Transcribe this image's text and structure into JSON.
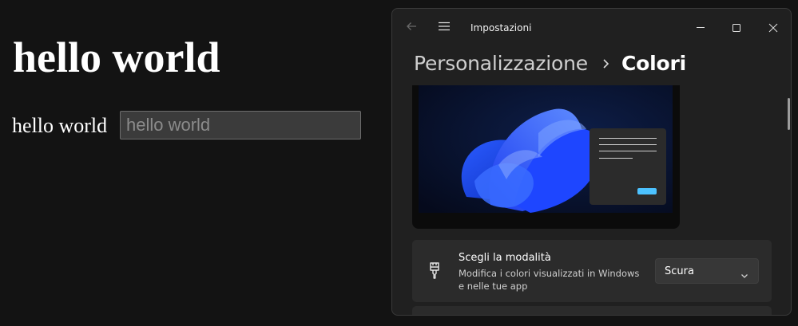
{
  "page": {
    "heading": "hello world",
    "label": "hello world",
    "input_placeholder": "hello world"
  },
  "window": {
    "title": "Impostazioni",
    "icons": {
      "back": "back-arrow-icon",
      "menu": "hamburger-menu-icon",
      "minimize": "minimize-icon",
      "maximize": "maximize-icon",
      "close": "close-icon"
    },
    "breadcrumb": {
      "parent": "Personalizzazione",
      "current": "Colori"
    },
    "mode_setting": {
      "icon": "paintbrush-icon",
      "title": "Scegli la modalità",
      "description": "Modifica i colori visualizzati in Windows e nelle tue app",
      "selected": "Scura"
    }
  },
  "colors": {
    "page_background": "#131313",
    "window_background": "#202020",
    "card_background": "#2b2b2b",
    "accent": "#4cc2ff"
  }
}
